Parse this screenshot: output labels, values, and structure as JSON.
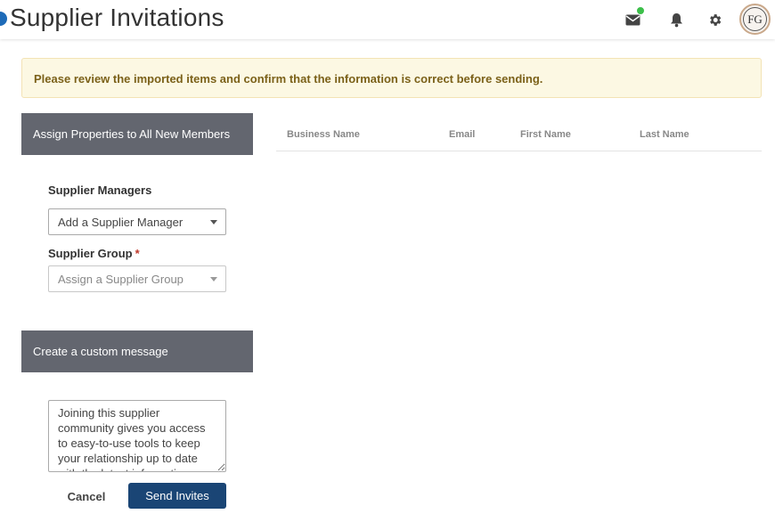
{
  "header": {
    "title": "Supplier Invitations",
    "icons": [
      "mail-icon",
      "bell-icon",
      "gear-icon"
    ],
    "avatar_initials": "FG",
    "status_color": "#3cbf4a"
  },
  "alert": {
    "text": "Please review the imported items and confirm that the information is correct before sending."
  },
  "assign_section": {
    "title": "Assign Properties to All New Members",
    "supplier_managers_label": "Supplier Managers",
    "supplier_managers_value": "Add a Supplier Manager",
    "supplier_group_label": "Supplier Group",
    "supplier_group_required": "*",
    "supplier_group_placeholder": "Assign a Supplier Group"
  },
  "message_section": {
    "title": "Create a custom message",
    "message": "Joining this supplier community gives you access to easy-to-use tools to keep your relationship up to date with the latest information about our company."
  },
  "actions": {
    "cancel_label": "Cancel",
    "send_label": "Send Invites"
  },
  "table": {
    "columns": [
      "Business Name",
      "Email",
      "First Name",
      "Last Name"
    ],
    "rows": []
  }
}
